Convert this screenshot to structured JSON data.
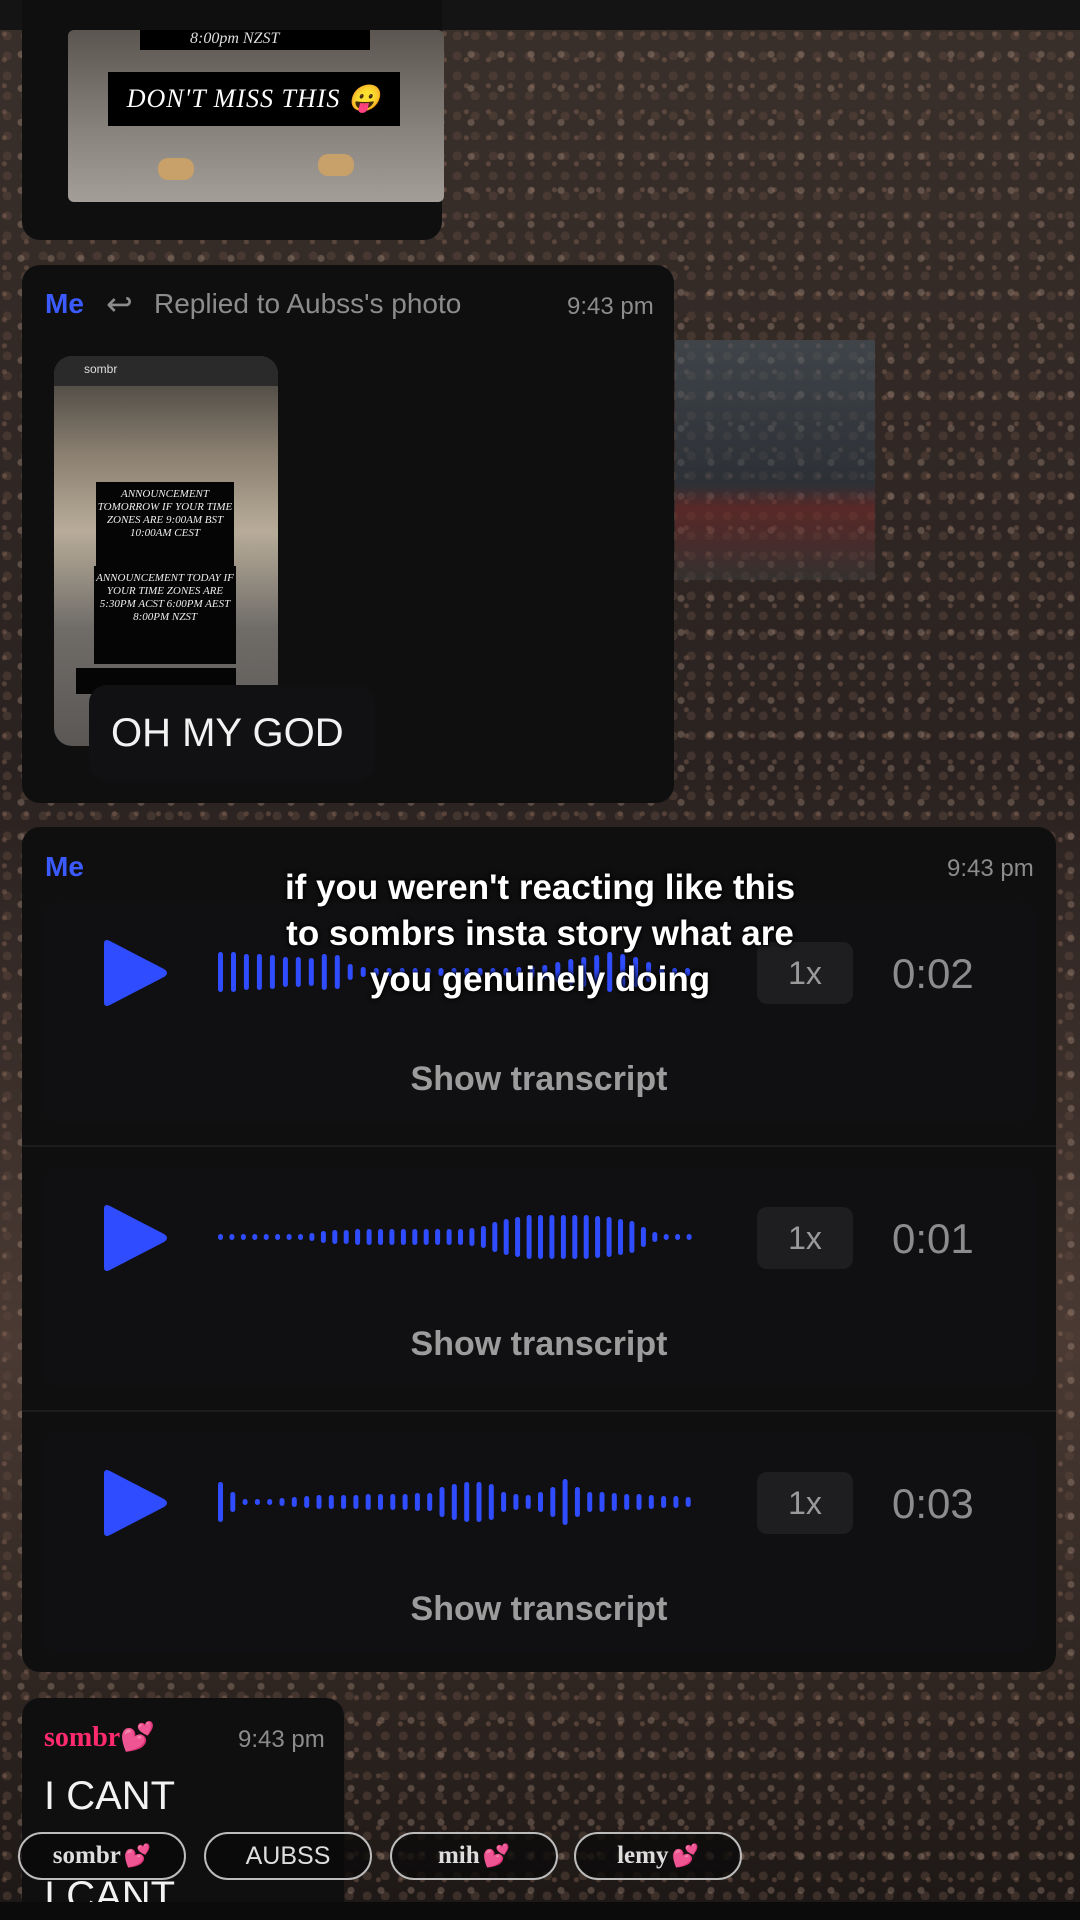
{
  "previous_message": {
    "story_time_line": "8:00pm NZST",
    "dont_miss": "DON'T MISS THIS 😛"
  },
  "reply_message": {
    "sender": "Me",
    "reply_label": "Replied to Aubss's photo",
    "time": "9:43 pm",
    "story": {
      "account": "sombr",
      "box1": "ANNOUNCEMENT TOMORROW IF YOUR TIME ZONES ARE 9:00am BST 10:00am CEST",
      "box2": "ANNOUNCEMENT TODAY IF YOUR TIME ZONES ARE 5:30pm ACST 6:00pm AEST 8:00pm NZST"
    },
    "text": "OH MY GOD"
  },
  "voice_message": {
    "sender": "Me",
    "time": "9:43 pm",
    "notes": [
      {
        "speed": "1x",
        "duration": "0:02",
        "transcript_label": "Show transcript"
      },
      {
        "speed": "1x",
        "duration": "0:01",
        "transcript_label": "Show transcript"
      },
      {
        "speed": "1x",
        "duration": "0:03",
        "transcript_label": "Show transcript"
      }
    ]
  },
  "caption": "if you weren't reacting like this to sombrs insta story what are you genuinely doing",
  "sombr_message": {
    "sender": "sombr💕",
    "time": "9:43 pm",
    "lines": [
      "I CANT",
      "I CANT"
    ]
  },
  "chips": [
    {
      "label": "sombr",
      "heart": "💕"
    },
    {
      "label": "AUBSS",
      "heart": ""
    },
    {
      "label": "mih",
      "heart": "💕"
    },
    {
      "label": "lemy",
      "heart": "💕"
    }
  ],
  "colors": {
    "accent": "#3b5bff",
    "card": "#0f0f10",
    "sombr_pink": "#ff2a6e"
  }
}
